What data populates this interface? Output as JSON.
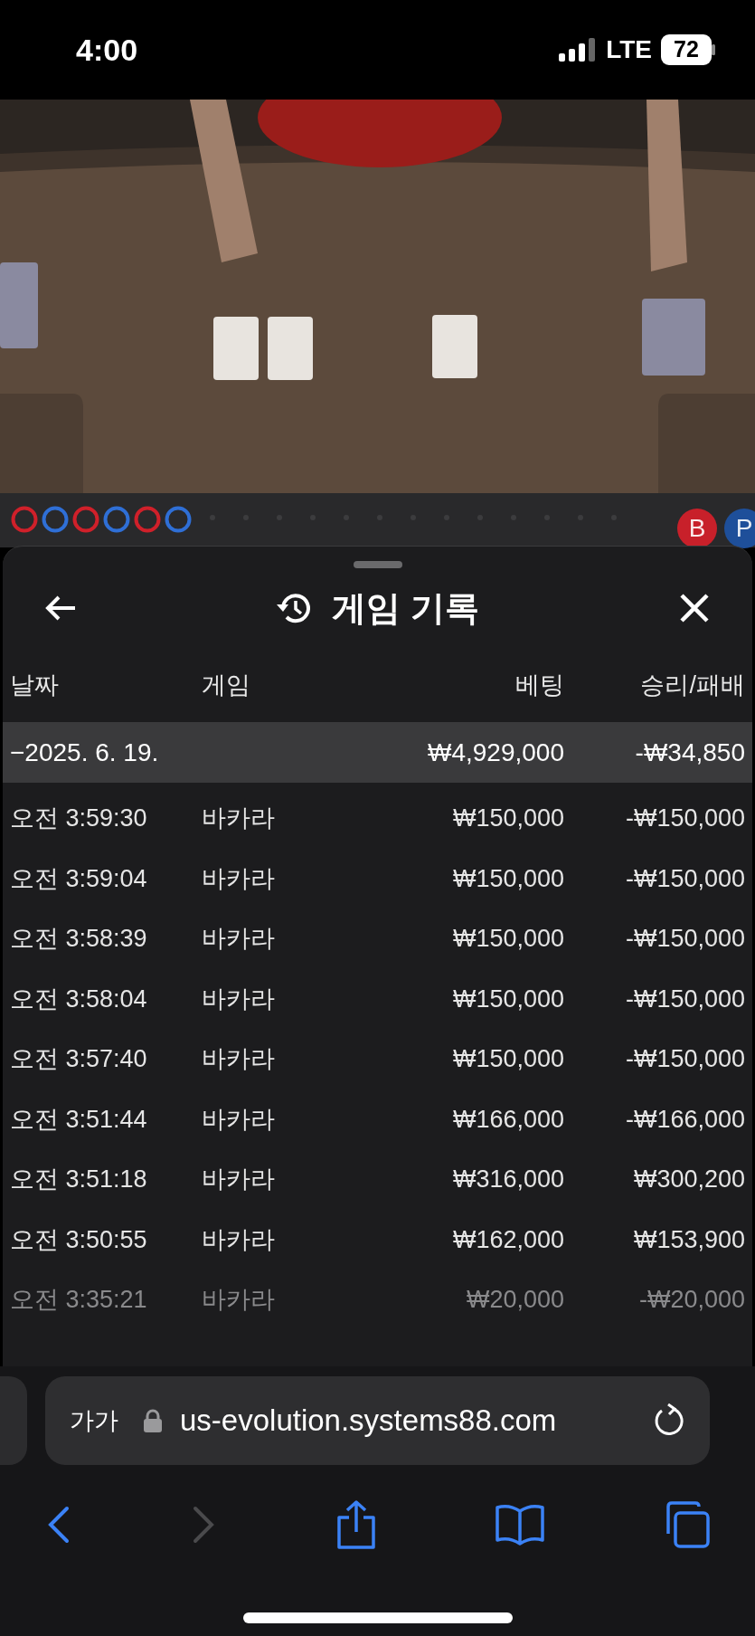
{
  "status_bar": {
    "time": "4:00",
    "network": "LTE",
    "battery": "72"
  },
  "bead_road": [
    {
      "color": "#d0202a"
    },
    {
      "color": "#2f6fd6"
    },
    {
      "color": "#d0202a"
    },
    {
      "color": "#2f6fd6"
    },
    {
      "color": "#d0202a"
    },
    {
      "color": "#2f6fd6"
    }
  ],
  "bet_badges": [
    {
      "label": "B",
      "color": "#c8202a"
    },
    {
      "label": "P",
      "color": "#1e4f9a"
    }
  ],
  "panel": {
    "title": "게임 기록",
    "columns": [
      "날짜",
      "게임",
      "베팅",
      "승리/패배"
    ],
    "rows": [
      {
        "kind": "date",
        "date": "−2025. 6. 19.",
        "bet": "₩4,929,000",
        "result": "-₩34,850"
      },
      {
        "kind": "game",
        "faded": false,
        "time": "오전 3:59:30",
        "game": "바카라",
        "bet": "₩150,000",
        "result": "-₩150,000"
      },
      {
        "kind": "game",
        "faded": false,
        "time": "오전 3:59:04",
        "game": "바카라",
        "bet": "₩150,000",
        "result": "-₩150,000"
      },
      {
        "kind": "game",
        "faded": false,
        "time": "오전 3:58:39",
        "game": "바카라",
        "bet": "₩150,000",
        "result": "-₩150,000"
      },
      {
        "kind": "game",
        "faded": false,
        "time": "오전 3:58:04",
        "game": "바카라",
        "bet": "₩150,000",
        "result": "-₩150,000"
      },
      {
        "kind": "game",
        "faded": false,
        "time": "오전 3:57:40",
        "game": "바카라",
        "bet": "₩150,000",
        "result": "-₩150,000"
      },
      {
        "kind": "game",
        "faded": false,
        "time": "오전 3:51:44",
        "game": "바카라",
        "bet": "₩166,000",
        "result": "-₩166,000"
      },
      {
        "kind": "game",
        "faded": false,
        "time": "오전 3:51:18",
        "game": "바카라",
        "bet": "₩316,000",
        "result": "₩300,200"
      },
      {
        "kind": "game",
        "faded": false,
        "time": "오전 3:50:55",
        "game": "바카라",
        "bet": "₩162,000",
        "result": "₩153,900"
      },
      {
        "kind": "game",
        "faded": true,
        "time": "오전 3:35:21",
        "game": "바카라",
        "bet": "₩20,000",
        "result": "-₩20,000"
      }
    ]
  },
  "browser": {
    "text_size": "가가",
    "url": "us-evolution.systems88.com",
    "forward_disabled": true
  }
}
